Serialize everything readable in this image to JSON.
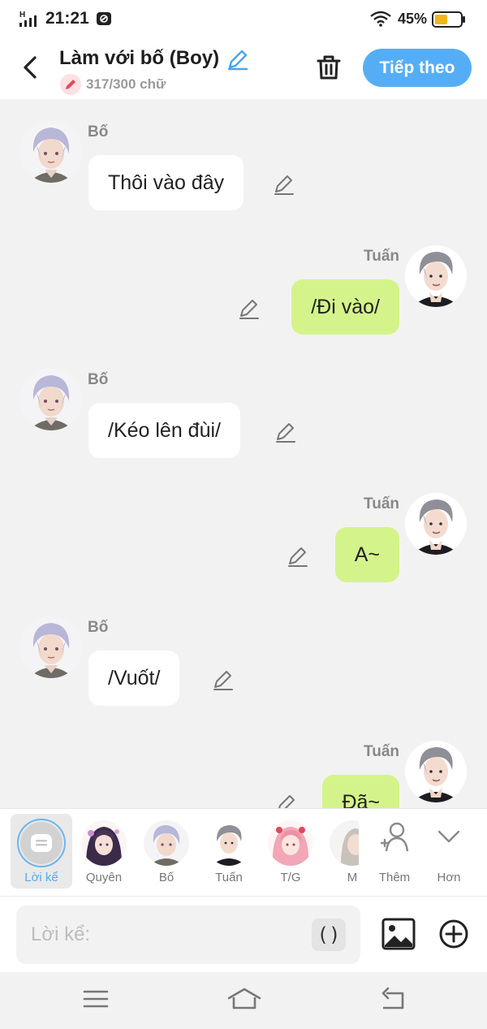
{
  "status_bar": {
    "network": "H",
    "time": "21:21",
    "battery": "45%"
  },
  "header": {
    "title": "Làm với bố (Boy)",
    "word_count": "317/300 chữ",
    "next_label": "Tiếp theo"
  },
  "colors": {
    "accent": "#55aef5",
    "right_bubble": "#d4f48b",
    "left_bubble": "#ffffff"
  },
  "messages": [
    {
      "sender": "Bố",
      "text": "Thôi vào đây",
      "side": "left"
    },
    {
      "sender": "Tuấn",
      "text": "/Đi vào/",
      "side": "right"
    },
    {
      "sender": "Bố",
      "text": "/Kéo lên đùi/",
      "side": "left"
    },
    {
      "sender": "Tuấn",
      "text": "A~",
      "side": "right"
    },
    {
      "sender": "Bố",
      "text": "/Vuốt/",
      "side": "left"
    },
    {
      "sender": "Tuấn",
      "text": "Đã~",
      "side": "right"
    }
  ],
  "characters": [
    {
      "name": "Lời kể",
      "icon": "narrator-bubble-icon",
      "selected": true
    },
    {
      "name": "Quyên",
      "icon": "avatar-quyen"
    },
    {
      "name": "Bố",
      "icon": "avatar-bo"
    },
    {
      "name": "Tuấn",
      "icon": "avatar-tuan"
    },
    {
      "name": "T/G",
      "icon": "avatar-tg"
    },
    {
      "name": "M",
      "icon": "avatar-m"
    }
  ],
  "actions": {
    "add_label": "Thêm",
    "more_label": "Hơn"
  },
  "input": {
    "placeholder": "Lời kể:",
    "paren_label": "()"
  }
}
